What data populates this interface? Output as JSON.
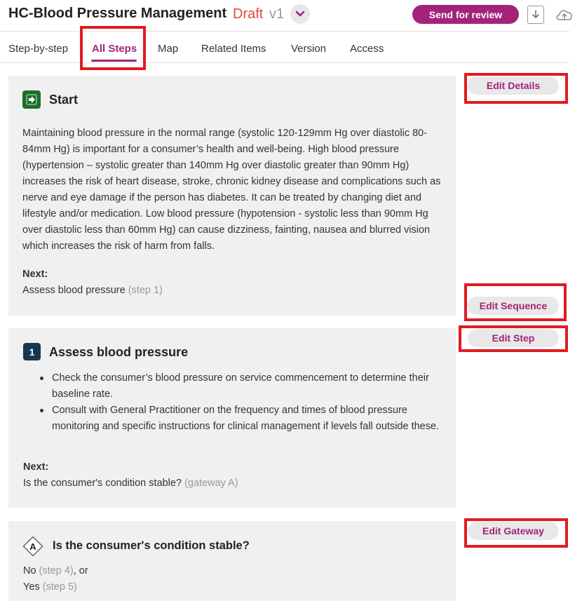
{
  "header": {
    "title": "HC-Blood Pressure Management",
    "status": "Draft",
    "version": "v1",
    "send_label": "Send for review",
    "icons": {
      "dropdown": "chevron-down-icon",
      "download": "download-icon",
      "upload": "cloud-upload-icon"
    }
  },
  "tabs": [
    {
      "label": "Step-by-step"
    },
    {
      "label": "All Steps",
      "active": true
    },
    {
      "label": "Map"
    },
    {
      "label": "Related Items"
    },
    {
      "label": "Version"
    },
    {
      "label": "Access"
    }
  ],
  "start": {
    "title": "Start",
    "text": "Maintaining blood pressure in the normal range (systolic 120-129mm Hg over diastolic 80-84mm Hg) is important for a consumer’s health and well-being. High blood pressure (hypertension – systolic greater than 140mm Hg over diastolic greater than 90mm Hg) increases the risk of heart disease, stroke, chronic kidney disease and complications such as nerve and eye damage if the person has diabetes. It can be treated by changing diet and lifestyle and/or medication. Low blood pressure (hypotension - systolic less than 90mm Hg over diastolic less than 60mm Hg) can cause dizziness, fainting, nausea and blurred vision which increases the risk of harm from falls.",
    "next_label": "Next:",
    "next_value": "Assess blood pressure",
    "next_ref": "(step 1)"
  },
  "step1": {
    "number": "1",
    "title": "Assess blood pressure",
    "bullets": [
      "Check the consumer’s blood pressure on service commencement to determine their baseline rate.",
      "Consult with General Practitioner on the frequency and times of blood pressure monitoring and specific instructions for clinical management if levels fall outside these."
    ],
    "next_label": "Next:",
    "next_value": "Is the consumer's condition stable?",
    "next_ref": "(gateway A)"
  },
  "gateway": {
    "letter": "A",
    "title": "Is the consumer's condition stable?",
    "options": [
      {
        "label": "No",
        "ref": "(step 4)",
        "suffix": ", or"
      },
      {
        "label": "Yes",
        "ref": "(step 5)",
        "suffix": ""
      }
    ]
  },
  "actions": {
    "edit_details": "Edit Details",
    "edit_sequence": "Edit Sequence",
    "edit_step": "Edit Step",
    "edit_gateway": "Edit Gateway"
  },
  "colors": {
    "accent": "#a3237a",
    "draft": "#e0493a",
    "start_icon": "#1e6e2a",
    "step_badge": "#17364f",
    "highlight": "#e01b22"
  }
}
